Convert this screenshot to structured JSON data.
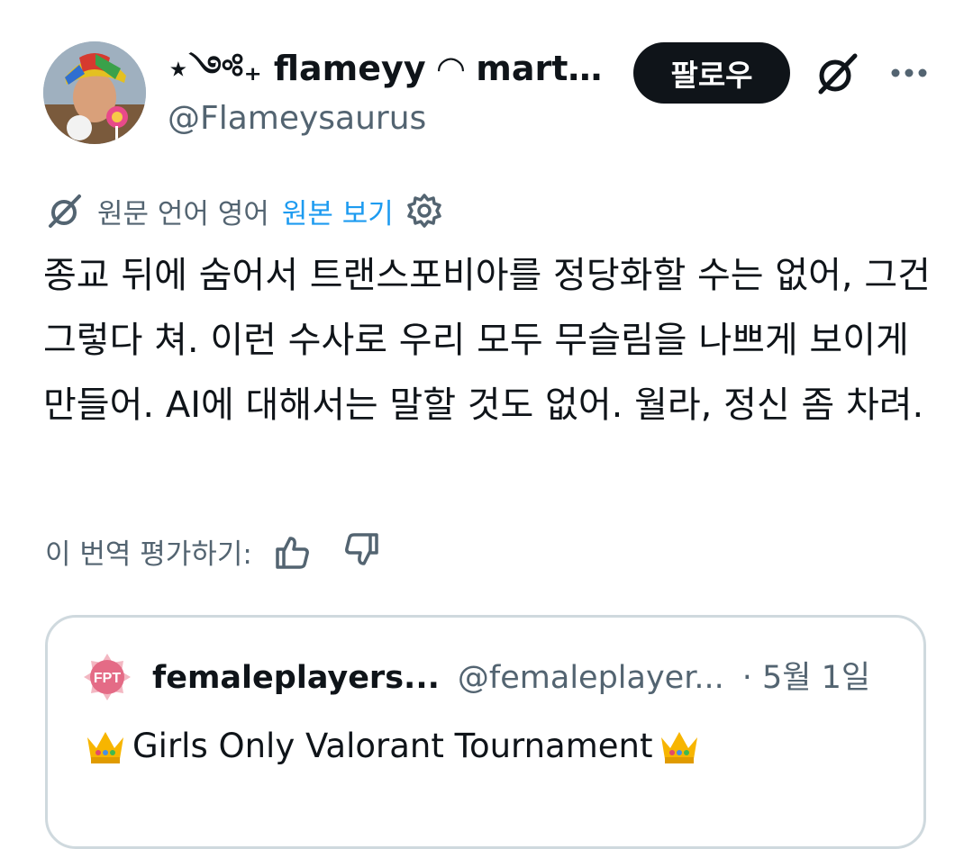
{
  "post": {
    "display_name": "⋆༺₊ flameyy ◠ martee...",
    "handle": "@Flameysaurus",
    "follow_label": "팔로우",
    "translation": {
      "original_language": "원문 언어 영어",
      "view_original": "원본 보기"
    },
    "text": "종교 뒤에 숨어서 트랜스포비아를 정당화할 수는 없어, 그건 그렇다 쳐. 이런 수사로 우리 모두 무슬림을 나쁘게 보이게 만들어. AI에 대해서는 말할 것도 없어. 월라, 정신 좀 차려.",
    "rate_label": "이 번역 평가하기:"
  },
  "quoted": {
    "avatar_text": "FPT",
    "display_name": "femaleplayers...",
    "handle": "@femaleplayer...",
    "date": "· 5월 1일",
    "text": "Girls Only Valorant Tournament"
  },
  "icons": {
    "grok": "grok-icon",
    "more": "more-icon",
    "gear": "gear-icon",
    "thumbs_up": "thumbs-up-icon",
    "thumbs_down": "thumbs-down-icon",
    "crown": "crown-emoji"
  },
  "colors": {
    "text": "#0f1419",
    "secondary": "#536471",
    "link": "#1d9bf0",
    "border": "#cfd9de",
    "button_bg": "#0f1419"
  }
}
